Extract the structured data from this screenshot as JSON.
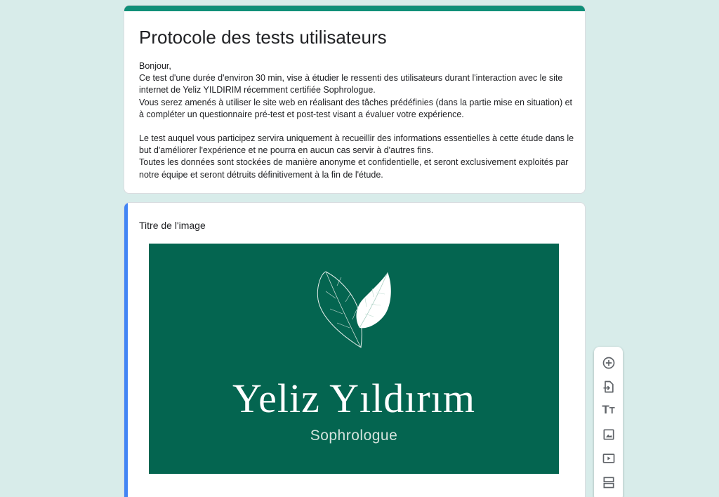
{
  "form": {
    "title": "Protocole des tests utilisateurs",
    "description": [
      "Bonjour,",
      "Ce test d'une durée d'environ 30 min, vise à étudier le ressenti des utilisateurs durant l'interaction avec le site internet de Yeliz YILDIRIM récemment certifiée Sophrologue.",
      "Vous serez amenés à utiliser le site web en réalisant des tâches prédéfinies (dans la partie mise en situation) et à compléter un questionnaire pré-test et post-test visant a évaluer votre expérience.",
      "",
      "Le test auquel vous participez servira uniquement à recueillir des informations essentielles à cette étude dans le but d'améliorer l'expérience et ne pourra en aucun cas servir à d'autres fins.",
      "Toutes les données sont stockées de manière anonyme et confidentielle, et seront exclusivement exploités par notre équipe et seront détruits définitivement à la fin de l'étude."
    ],
    "header_color": "#0f8f78"
  },
  "image_item": {
    "title": "Titre de l'image",
    "accent_color": "#4285f4",
    "logo": {
      "name": "Yeliz Yıldırım",
      "subtitle": "Sophrologue",
      "background": "#046550"
    }
  },
  "toolbar": {
    "items": [
      {
        "icon": "add-question-icon"
      },
      {
        "icon": "import-questions-icon"
      },
      {
        "icon": "add-title-icon",
        "label": "Tт"
      },
      {
        "icon": "add-image-icon"
      },
      {
        "icon": "add-video-icon"
      },
      {
        "icon": "add-section-icon"
      }
    ]
  },
  "colors": {
    "page_background": "#d8ecea",
    "icon": "#5f6368"
  }
}
